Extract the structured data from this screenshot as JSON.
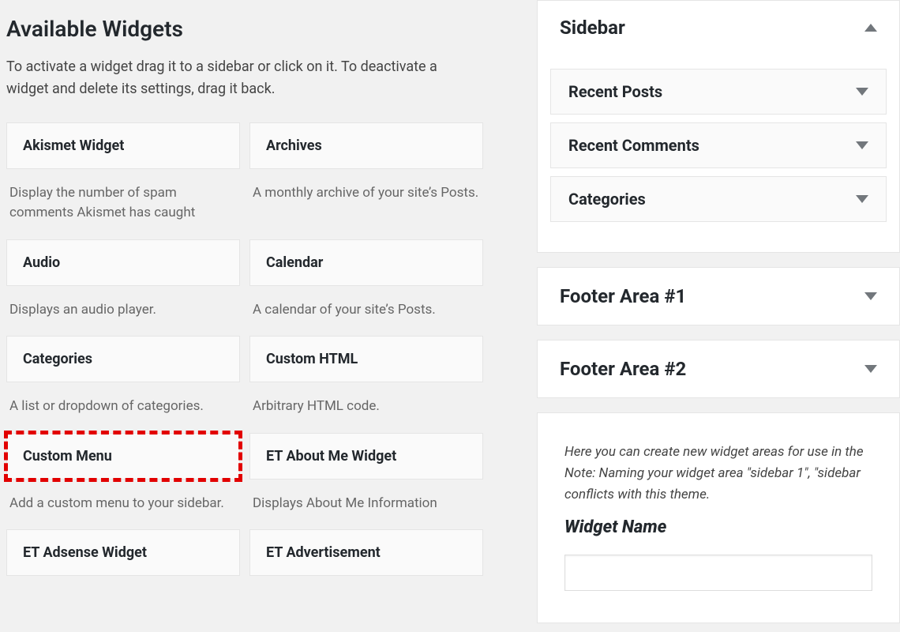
{
  "header": {
    "title": "Available Widgets",
    "description": "To activate a widget drag it to a sidebar or click on it. To deactivate a widget and delete its settings, drag it back."
  },
  "widgets": [
    {
      "name": "Akismet Widget",
      "desc": "Display the number of spam comments Akismet has caught",
      "highlight": false
    },
    {
      "name": "Archives",
      "desc": "A monthly archive of your site’s Posts.",
      "highlight": false
    },
    {
      "name": "Audio",
      "desc": "Displays an audio player.",
      "highlight": false
    },
    {
      "name": "Calendar",
      "desc": "A calendar of your site’s Posts.",
      "highlight": false
    },
    {
      "name": "Categories",
      "desc": "A list or dropdown of categories.",
      "highlight": false
    },
    {
      "name": "Custom HTML",
      "desc": "Arbitrary HTML code.",
      "highlight": false
    },
    {
      "name": "Custom Menu",
      "desc": "Add a custom menu to your sidebar.",
      "highlight": true
    },
    {
      "name": "ET About Me Widget",
      "desc": "Displays About Me Information",
      "highlight": false
    },
    {
      "name": "ET Adsense Widget",
      "desc": "",
      "highlight": false
    },
    {
      "name": "ET Advertisement",
      "desc": "",
      "highlight": false
    }
  ],
  "areas": {
    "sidebar": {
      "title": "Sidebar",
      "items": [
        {
          "label": "Recent Posts"
        },
        {
          "label": "Recent Comments"
        },
        {
          "label": "Categories"
        }
      ]
    },
    "footer1": {
      "title": "Footer Area #1"
    },
    "footer2": {
      "title": "Footer Area #2"
    }
  },
  "create": {
    "desc": "Here you can create new widget areas for use in the  Note: Naming your widget area \"sidebar 1\", \"sidebar  conflicts with this theme.",
    "label": "Widget Name"
  }
}
